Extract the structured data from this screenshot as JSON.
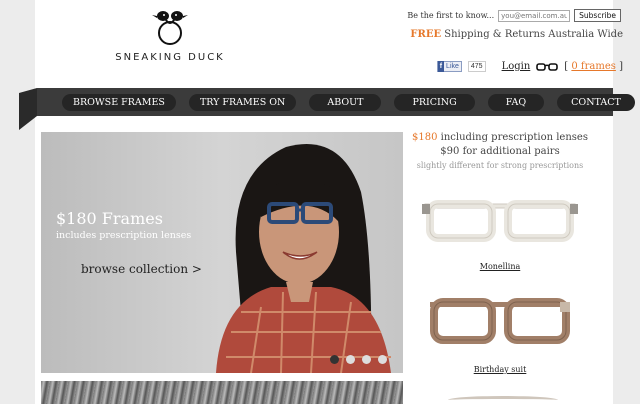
{
  "brand": {
    "name": "SNEAKING DUCK"
  },
  "newsletter": {
    "label": "Be the first to know...",
    "placeholder": "you@email.com.au",
    "button": "Subscribe"
  },
  "shipping": {
    "free": "FREE",
    "rest": " Shipping & Returns Australia Wide"
  },
  "toolbar": {
    "fb_like": "Like",
    "fb_count": "475",
    "login": "Login",
    "frames_prefix": "[ ",
    "frames_link": "0 frames",
    "frames_suffix": " ]"
  },
  "nav": {
    "items": [
      "BROWSE FRAMES",
      "TRY FRAMES ON",
      "ABOUT",
      "PRICING",
      "FAQ",
      "CONTACT"
    ]
  },
  "hero": {
    "title": "$180 Frames",
    "subtitle": "includes prescription lenses",
    "cta": "browse collection >"
  },
  "side": {
    "promo_price": "$180",
    "promo_line1": " including prescription lenses",
    "promo_line2": "$90 for additional pairs",
    "promo_line3": "slightly different for strong prescriptions"
  },
  "products": [
    {
      "name": "Monellina",
      "frame_color": "#e9e6df"
    },
    {
      "name": "Birthday suit",
      "frame_color": "#a17f68"
    }
  ],
  "colors": {
    "accent": "#e6782b",
    "nav_bg": "#3b3b3b",
    "pill_bg": "#252525"
  },
  "icons": [
    "duck-logo-icon",
    "glasses-icon",
    "facebook-icon"
  ]
}
